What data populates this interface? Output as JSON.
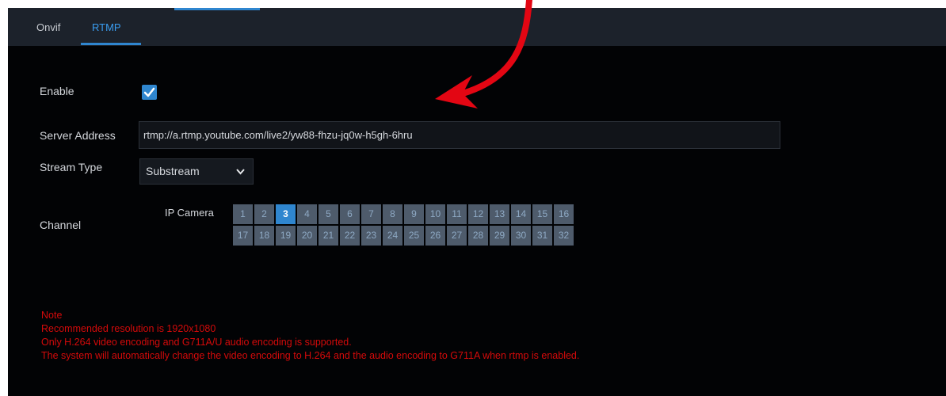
{
  "tabs": [
    {
      "label": "Onvif"
    },
    {
      "label": "RTMP",
      "active": true
    }
  ],
  "enable": {
    "label": "Enable",
    "checked": true
  },
  "server_address": {
    "label": "Server Address",
    "value": "rtmp://a.rtmp.youtube.com/live2/yw88-fhzu-jq0w-h5gh-6hru"
  },
  "stream_type": {
    "label": "Stream Type",
    "selected": "Substream"
  },
  "channel": {
    "label": "Channel",
    "group_label": "IP Camera",
    "row1": [
      "1",
      "2",
      "3",
      "4",
      "5",
      "6",
      "7",
      "8",
      "9",
      "10",
      "11",
      "12",
      "13",
      "14",
      "15",
      "16"
    ],
    "row2": [
      "17",
      "18",
      "19",
      "20",
      "21",
      "22",
      "23",
      "24",
      "25",
      "26",
      "27",
      "28",
      "29",
      "30",
      "31",
      "32"
    ],
    "selected": "3"
  },
  "note": {
    "title": "Note",
    "lines": [
      "Recommended resolution is 1920x1080",
      "Only H.264 video encoding and G711A/U audio encoding is supported.",
      "The system will automatically change the video encoding to H.264 and the audio encoding to G711A when rtmp is enabled."
    ]
  },
  "colors": {
    "accent": "#2f86cf",
    "note_text": "#d40a0a",
    "annotation_arrow": "#e30613"
  },
  "icons": {
    "checkbox": "check-icon",
    "dropdown": "chevron-down-icon",
    "annotation": "curved-arrow-icon"
  }
}
